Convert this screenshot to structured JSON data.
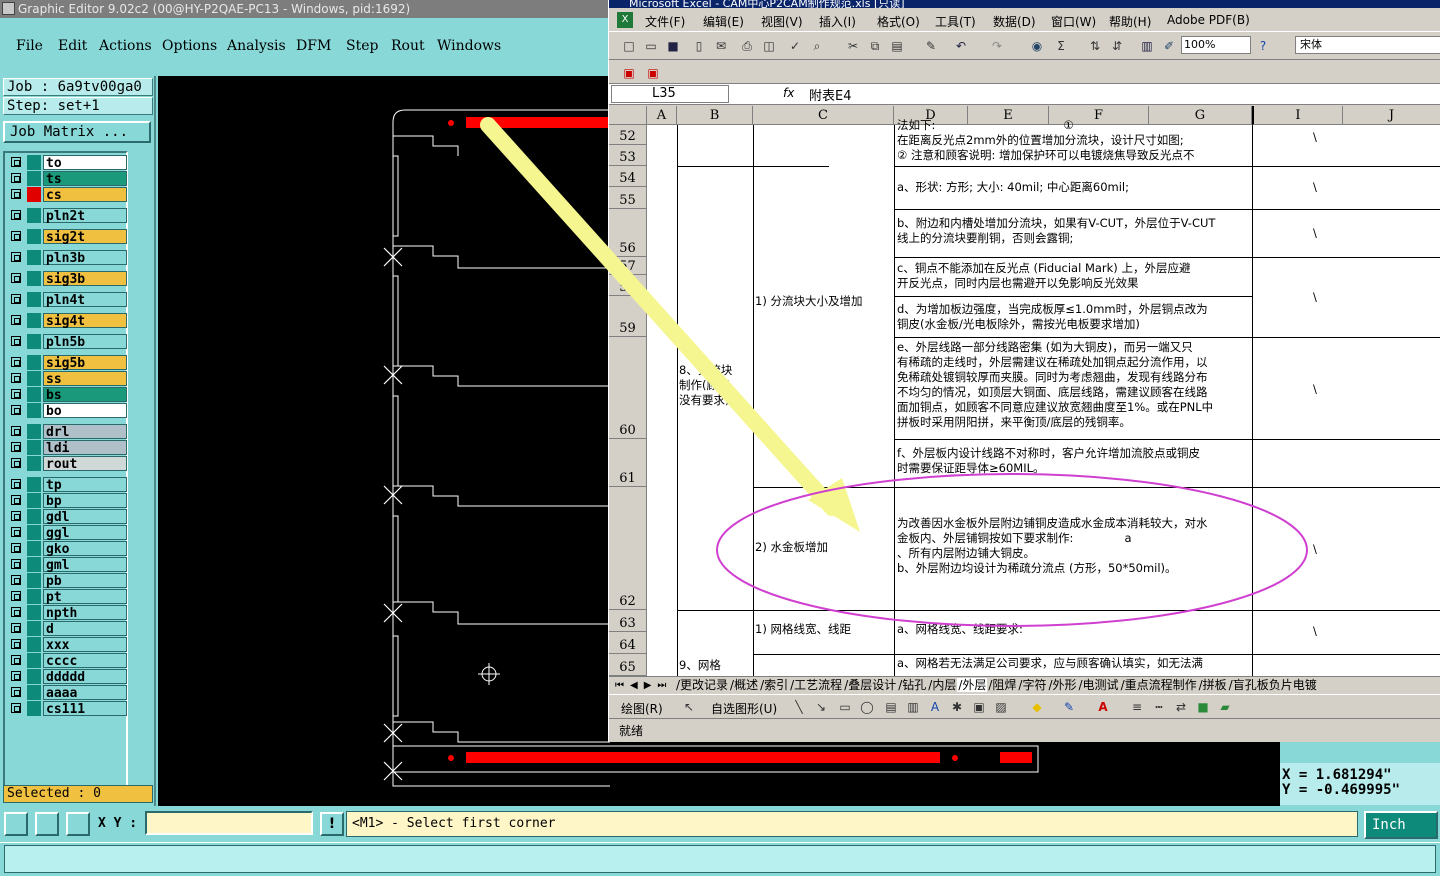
{
  "genesis": {
    "title": "Graphic Editor 9.02c2 (00@HY-P2QAE-PC13 - Windows, pid:1692)",
    "menu": [
      "File",
      "Edit",
      "Actions",
      "Options",
      "Analysis",
      "DFM",
      "Step",
      "Rout",
      "Windows"
    ],
    "job": "Job : 6a9tv00ga0",
    "step": "Step: set+1",
    "job_matrix_label": "Job Matrix ...",
    "layers": [
      {
        "name": "to",
        "bg": "#ffffff",
        "swatch": "#0e8a7a"
      },
      {
        "name": "ts",
        "bg": "#1a9a7a",
        "swatch": "#0e8a7a"
      },
      {
        "name": "cs",
        "bg": "#f0c040",
        "swatch": "#e00000"
      },
      {
        "name": "pln2t",
        "bg": "#88d8d8",
        "swatch": "#0e8a7a"
      },
      {
        "name": "sig2t",
        "bg": "#f0c040",
        "swatch": "#0e8a7a"
      },
      {
        "name": "pln3b",
        "bg": "#88d8d8",
        "swatch": "#0e8a7a"
      },
      {
        "name": "sig3b",
        "bg": "#f0c040",
        "swatch": "#0e8a7a"
      },
      {
        "name": "pln4t",
        "bg": "#88d8d8",
        "swatch": "#0e8a7a"
      },
      {
        "name": "sig4t",
        "bg": "#f0c040",
        "swatch": "#0e8a7a"
      },
      {
        "name": "pln5b",
        "bg": "#88d8d8",
        "swatch": "#0e8a7a"
      },
      {
        "name": "sig5b",
        "bg": "#f0c040",
        "swatch": "#0e8a7a"
      },
      {
        "name": "ss",
        "bg": "#f0c040",
        "swatch": "#0e8a7a"
      },
      {
        "name": "bs",
        "bg": "#1a9a7a",
        "swatch": "#0e8a7a"
      },
      {
        "name": "bo",
        "bg": "#ffffff",
        "swatch": "#0e8a7a"
      },
      {
        "name": "drl",
        "bg": "#b0c0c8",
        "swatch": "#0e8a7a"
      },
      {
        "name": "ldi",
        "bg": "#b0c0c8",
        "swatch": "#0e8a7a"
      },
      {
        "name": "rout",
        "bg": "#d0d8d8",
        "swatch": "#0e8a7a"
      },
      {
        "name": "tp",
        "bg": "#88d8d8",
        "swatch": "#0e8a7a"
      },
      {
        "name": "bp",
        "bg": "#88d8d8",
        "swatch": "#0e8a7a"
      },
      {
        "name": "gdl",
        "bg": "#88d8d8",
        "swatch": "#0e8a7a"
      },
      {
        "name": "ggl",
        "bg": "#88d8d8",
        "swatch": "#0e8a7a"
      },
      {
        "name": "gko",
        "bg": "#88d8d8",
        "swatch": "#0e8a7a"
      },
      {
        "name": "gml",
        "bg": "#88d8d8",
        "swatch": "#0e8a7a"
      },
      {
        "name": "pb",
        "bg": "#88d8d8",
        "swatch": "#0e8a7a"
      },
      {
        "name": "pt",
        "bg": "#88d8d8",
        "swatch": "#0e8a7a"
      },
      {
        "name": "npth",
        "bg": "#88d8d8",
        "swatch": "#0e8a7a"
      },
      {
        "name": "d",
        "bg": "#88d8d8",
        "swatch": "#0e8a7a"
      },
      {
        "name": "xxx",
        "bg": "#88d8d8",
        "swatch": "#0e8a7a"
      },
      {
        "name": "cccc",
        "bg": "#88d8d8",
        "swatch": "#0e8a7a"
      },
      {
        "name": "ddddd",
        "bg": "#88d8d8",
        "swatch": "#0e8a7a"
      },
      {
        "name": "aaaa",
        "bg": "#88d8d8",
        "swatch": "#0e8a7a"
      },
      {
        "name": "cs111",
        "bg": "#88d8d8",
        "swatch": "#0e8a7a"
      }
    ],
    "selected": "Selected : 0",
    "xy_label": "X Y :",
    "xy_value": "",
    "prompt": "<M1> - Select first corner",
    "unit": "Inch",
    "coord_x": "X = 1.681294\"",
    "coord_y": "Y = -0.469995\""
  },
  "excel": {
    "title": "Microsoft Excel - CAM中心P2CAM制作规范.xls [只读]",
    "menu": [
      "文件(F)",
      "编辑(E)",
      "视图(V)",
      "插入(I)",
      "格式(O)",
      "工具(T)",
      "数据(D)",
      "窗口(W)",
      "帮助(H)",
      "Adobe PDF(B)"
    ],
    "zoom": "100%",
    "font": "宋体",
    "namebox": "L35",
    "fx": "fx",
    "formula": "附表E4",
    "columns": [
      "A",
      "B",
      "C",
      "D",
      "E",
      "F",
      "G",
      "I",
      "J"
    ],
    "rows": [
      "52",
      "53",
      "54",
      "55",
      "56",
      "57",
      "58",
      "59",
      "60",
      "61",
      "62",
      "63",
      "64",
      "65"
    ],
    "cells": {
      "d52": "法如下:                                   ①\n在距离反光点2mm外的位置增加分流块，设计尺寸如图;\n② 注意和顾客说明: 增加保护环可以电镀烧焦导致反光点不",
      "d54": "a、形状: 方形; 大小: 40mil; 中心距离60mil;",
      "d56": "b、附边和内槽处增加分流块，如果有V-CUT，外层位于V-CUT\n线上的分流块要削铜，否则会露铜;",
      "d57": "c、铜点不能添加在反光点 (Fiducial Mark) 上，外层应避\n开反光点，同时内层也需避开以免影响反光效果",
      "d59": "d、为增加板边强度，当完成板厚≤1.0mm时，外层铜点改为\n铜皮(水金板/光电板除外，需按光电板要求增加)",
      "d60": "e、外层线路一部分线路密集 (如为大铜皮)，而另一端又只\n有稀疏的走线时，外层需建议在稀疏处加铜点起分流作用，以\n免稀疏处镀铜较厚而夹膜。同时为考虑翘曲，发现有线路分布\n不均匀的情况，如顶层大铜面、底层线路，需建议顾客在线路\n面加铜点，如顾客不同意应建议放宽翘曲度至1%。或在PNL中\n拼板时采用阴阳拼，来平衡顶/底层的残铜率。",
      "d61": "f、外层板内设计线路不对称时，客户允许增加流胶点或铜皮\n时需要保证距导体≥60MIL。",
      "d62": "为改善因水金板外层附边铺铜皮造成水金成本消耗较大，对水\n金板内、外层铺铜按如下要求制作:              a\n、所有内层附边铺大铜皮。\nb、外层附边均设计为稀疏分流点 (方形，50*50mil)。",
      "d63": "a、网格线宽、线距要求:",
      "d65": "a、网格若无法满足公司要求，应与顾客确认填实，如无法满",
      "c56": "1) 分流块大小及增加",
      "b60": "8、分流块\n制作(顾客\n没有要求)",
      "c62": "2) 水金板增加",
      "c63": "1) 网格线宽、线距",
      "b65": "9、网格",
      "slash": "\\"
    },
    "sheet_tabs": [
      "更改记录",
      "概述",
      "索引",
      "工艺流程",
      "叠层设计",
      "钻孔",
      "内层",
      "外层",
      "阻焊",
      "字符",
      "外形",
      "电测试",
      "重点流程制作",
      "拼板",
      "盲孔板负片电镀"
    ],
    "active_tab": "外层",
    "draw_label": "绘图(R)",
    "autoshape_label": "自选图形(U)",
    "status": "就绪"
  }
}
